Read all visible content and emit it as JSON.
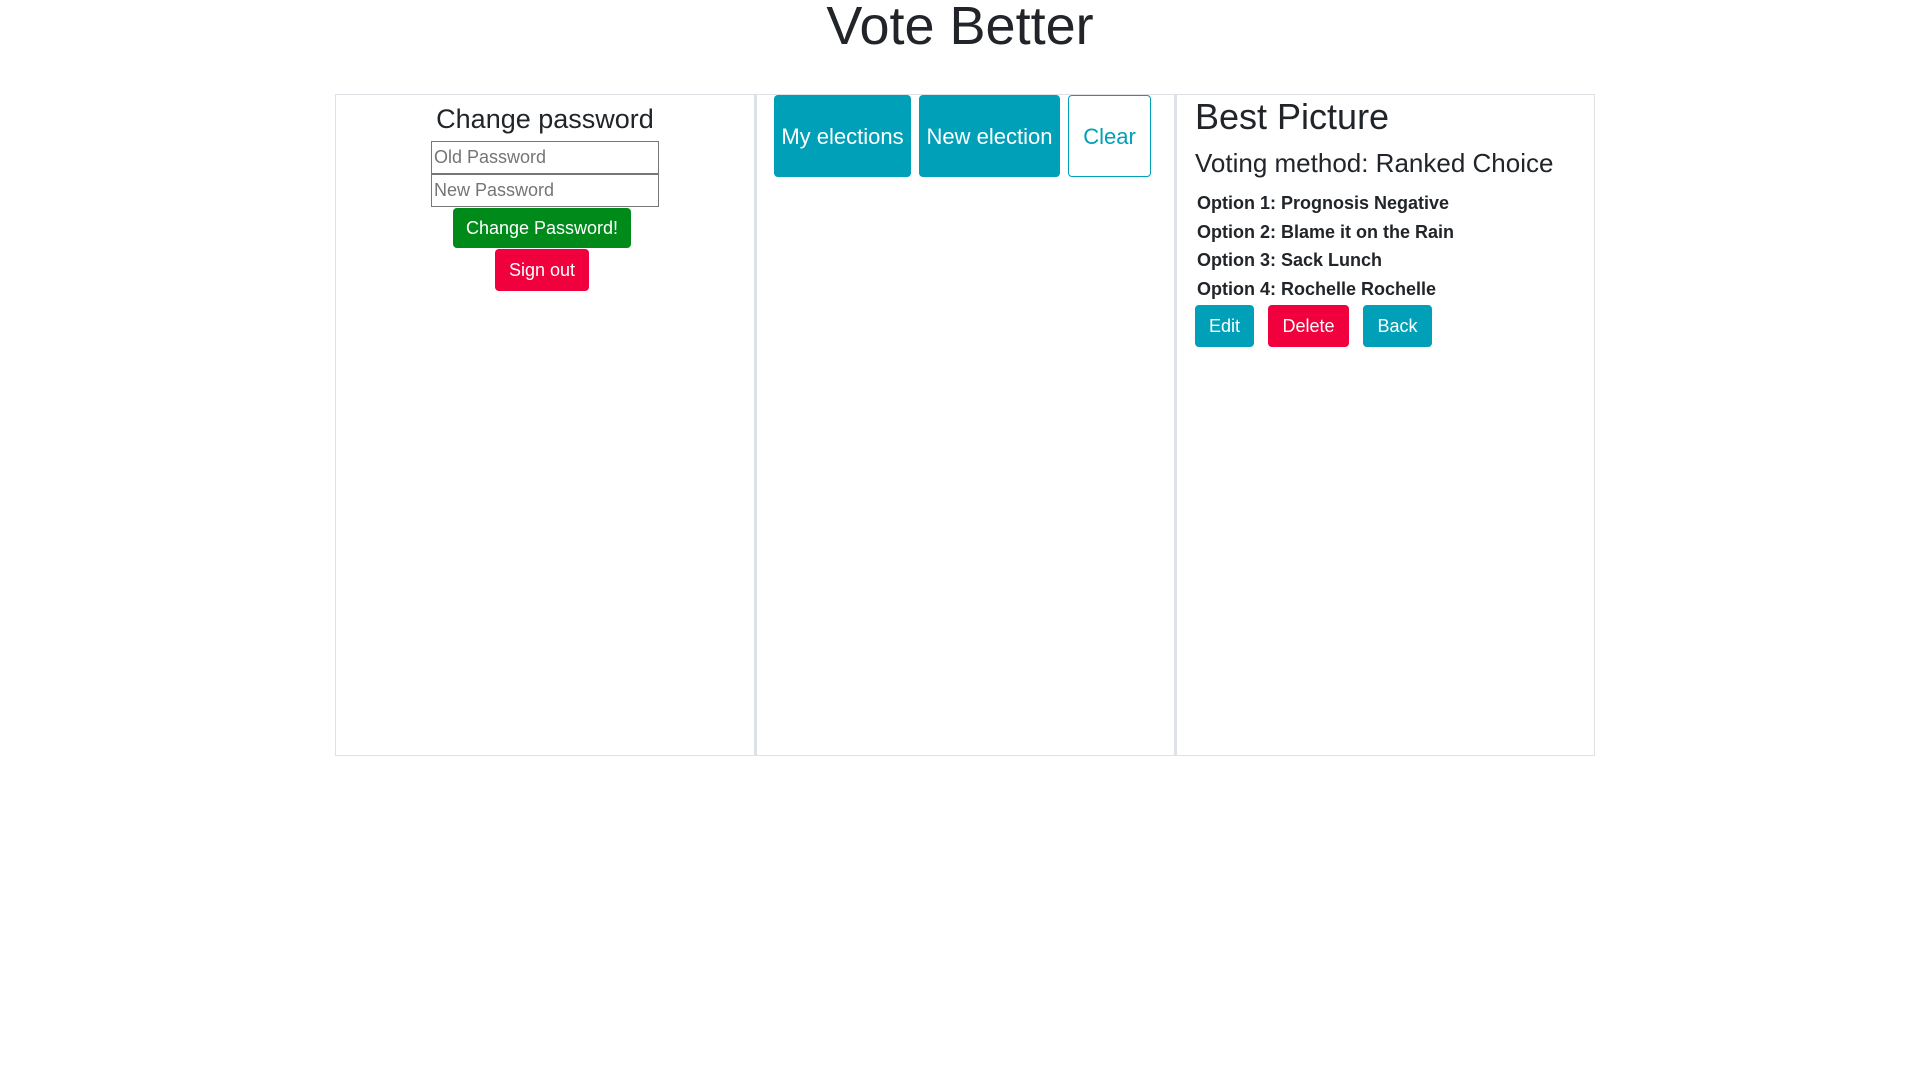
{
  "app": {
    "title": "Vote Better"
  },
  "account": {
    "heading": "Change password",
    "old_password_placeholder": "Old Password",
    "new_password_placeholder": "New Password",
    "change_password_label": "Change Password!",
    "sign_out_label": "Sign out"
  },
  "elections_toolbar": {
    "my_elections_label": "My elections",
    "new_election_label": "New election",
    "clear_label": "Clear"
  },
  "election": {
    "title": "Best Picture",
    "voting_method": "Voting method: Ranked Choice",
    "options": [
      {
        "label": "Option 1: Prognosis Negative"
      },
      {
        "label": "Option 2: Blame it on the Rain"
      },
      {
        "label": "Option 3: Sack Lunch"
      },
      {
        "label": "Option 4: Rochelle Rochelle"
      }
    ],
    "edit_label": "Edit",
    "delete_label": "Delete",
    "back_label": "Back"
  },
  "colors": {
    "info": "#00a0b8",
    "success": "#008a1a",
    "danger": "#f0003c",
    "border": "#dee2e6",
    "text": "#212529"
  }
}
